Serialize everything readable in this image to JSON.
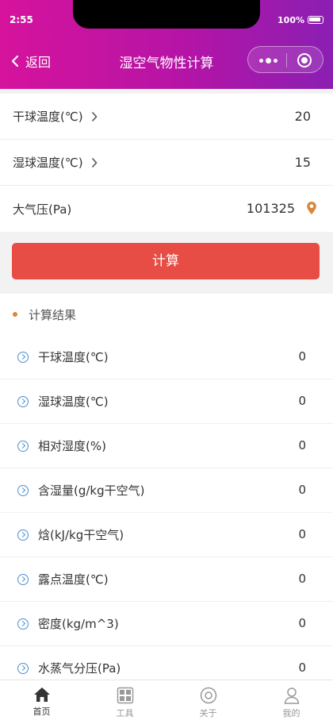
{
  "status": {
    "time": "2:55",
    "battery": "100%"
  },
  "nav": {
    "back": "返回",
    "title": "湿空气物性计算"
  },
  "inputs": [
    {
      "label": "干球温度(℃)",
      "value": "20"
    },
    {
      "label": "湿球温度(℃)",
      "value": "15"
    },
    {
      "label": "大气压(Pa)",
      "value": "101325"
    }
  ],
  "button": {
    "calculate": "计算"
  },
  "results": {
    "heading": "计算结果",
    "rows": [
      {
        "label": "干球温度(℃)",
        "value": "0"
      },
      {
        "label": "湿球温度(℃)",
        "value": "0"
      },
      {
        "label": "相对湿度(%)",
        "value": "0"
      },
      {
        "label": "含湿量(g/kg干空气)",
        "value": "0"
      },
      {
        "label": "焓(kJ/kg干空气)",
        "value": "0"
      },
      {
        "label": "露点温度(℃)",
        "value": "0"
      },
      {
        "label": "密度(kg/m^3)",
        "value": "0"
      },
      {
        "label": "水蒸气分压(Pa)",
        "value": "0"
      }
    ]
  },
  "tabs": [
    {
      "label": "首页",
      "icon": "home-icon",
      "active": true
    },
    {
      "label": "工具",
      "icon": "tools-grid-icon"
    },
    {
      "label": "关于",
      "icon": "about-target-icon"
    },
    {
      "label": "我的",
      "icon": "user-icon"
    }
  ],
  "colors": {
    "header_start": "#d6139c",
    "header_end": "#8a1fb2",
    "button": "#e74c45",
    "result_dot": "#d9873c",
    "row_icon": "#4a8fd0",
    "pin": "#d9873c"
  }
}
